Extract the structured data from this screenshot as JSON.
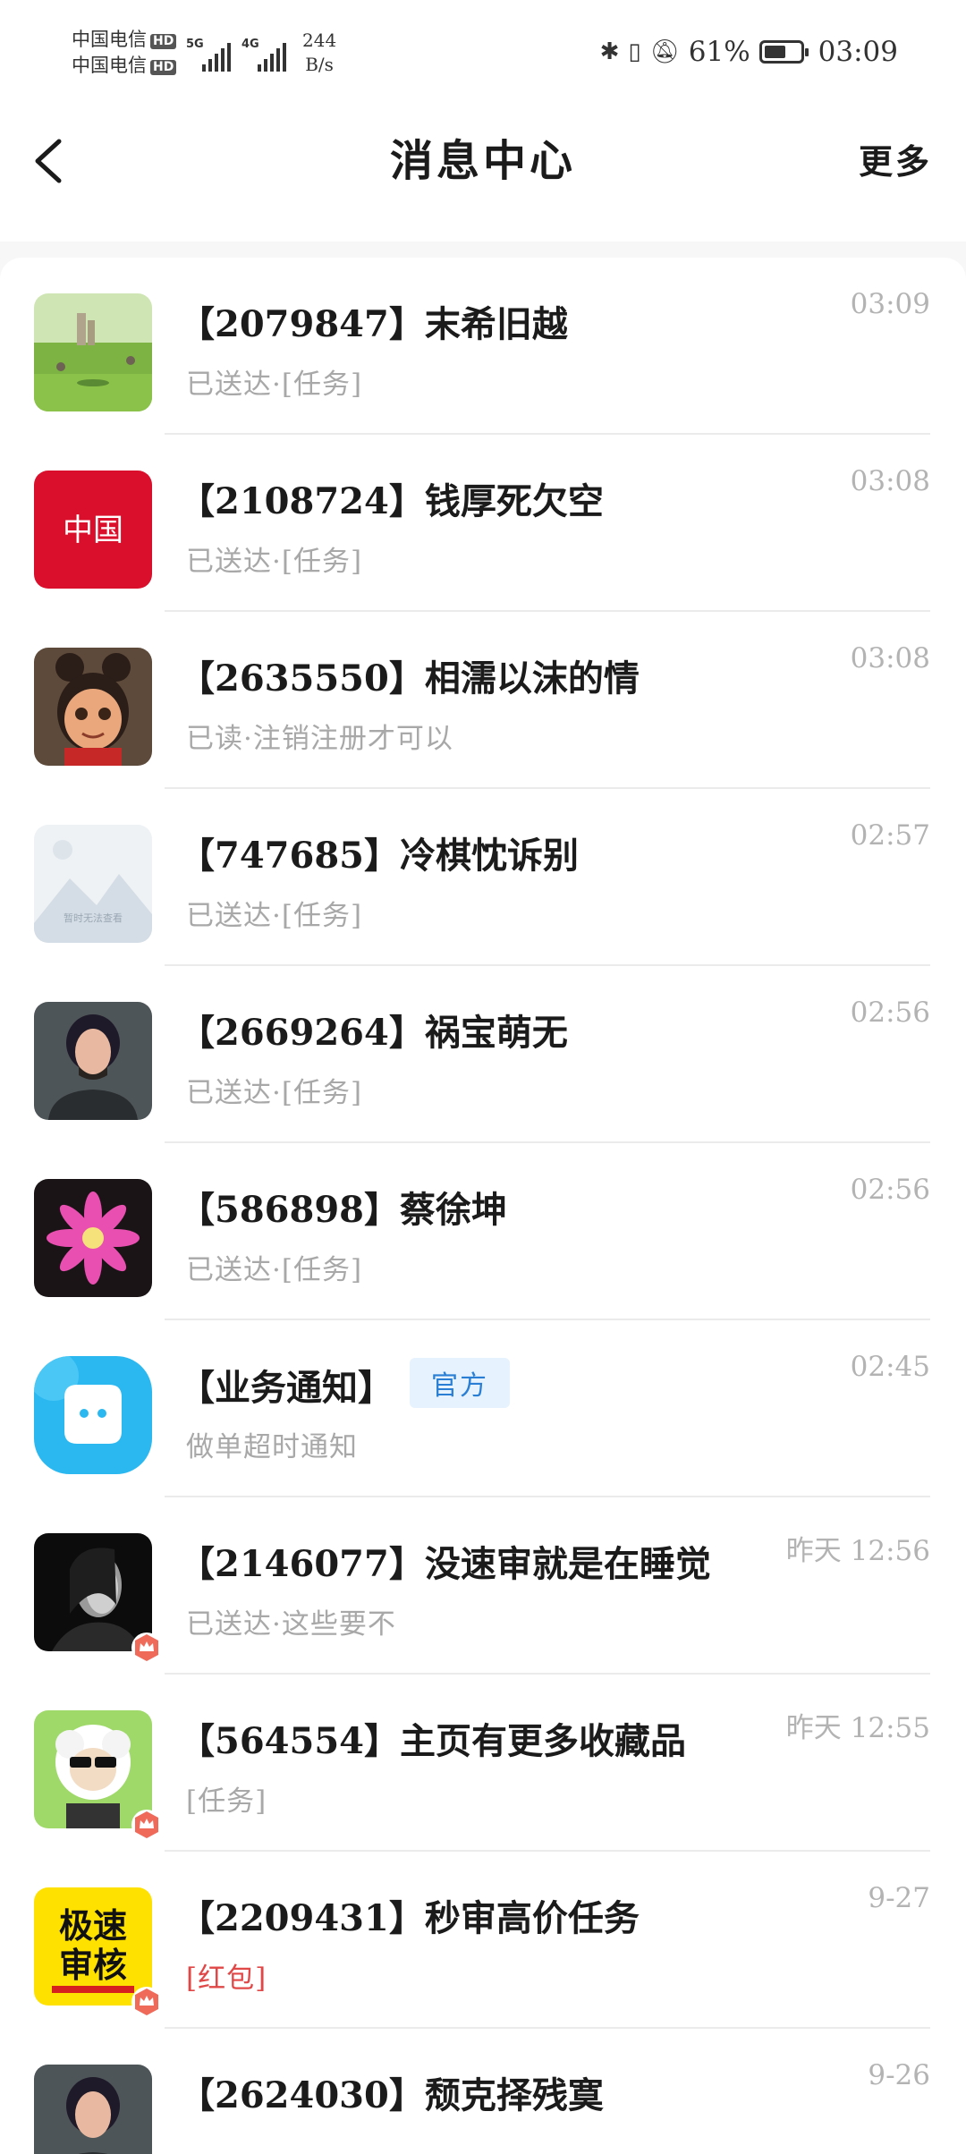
{
  "status_bar": {
    "carrier_1": "中国电信",
    "carrier_2": "中国电信",
    "hd": "HD",
    "net_1": "5G",
    "net_2": "4G",
    "speed_value": "244",
    "speed_unit": "B/s",
    "battery": "61%",
    "battery_level": 0.61,
    "time": "03:09",
    "icons": [
      "bluetooth-icon",
      "vibrate-icon",
      "mute-bell-icon",
      "battery-icon"
    ]
  },
  "header": {
    "title": "消息中心",
    "more_label": "更多",
    "back_icon": "chevron-left-icon"
  },
  "messages": [
    {
      "name": "【2079847】末希旧越",
      "sub": "已送达·[任务]",
      "time": "03:09",
      "avatar": "landscape-photo"
    },
    {
      "name": "【2108724】钱厚死欠空",
      "sub": "已送达·[任务]",
      "time": "03:08",
      "avatar": "red-logo",
      "avatar_text": "中国"
    },
    {
      "name": "【2635550】相濡以沫的情",
      "sub": "已读·注销注册才可以",
      "time": "03:08",
      "avatar": "cartoon-girl"
    },
    {
      "name": "【747685】冷棋忱诉别",
      "sub": "已送达·[任务]",
      "time": "02:57",
      "avatar": "placeholder-image",
      "avatar_text": "暂时无法查看"
    },
    {
      "name": "【2669264】祸宝萌无",
      "sub": "已送达·[任务]",
      "time": "02:56",
      "avatar": "person-silhouette"
    },
    {
      "name": "【586898】蔡徐坤",
      "sub": "已送达·[任务]",
      "time": "02:56",
      "avatar": "pink-flower"
    },
    {
      "name": "【业务通知】",
      "badge": "官方",
      "sub": "做单超时通知",
      "time": "02:45",
      "avatar": "chat-bubble"
    },
    {
      "name": "【2146077】没速审就是在睡觉",
      "sub": "已送达·这些要不",
      "time": "昨天 12:56",
      "avatar": "dark-portrait",
      "crown": true
    },
    {
      "name": "【564554】主页有更多收藏品",
      "sub": "[任务]",
      "time": "昨天 12:55",
      "avatar": "cartoon-sheep",
      "crown": true
    },
    {
      "name": "【2209431】秒审高价任务",
      "sub": "[红包]",
      "sub_color": "#e04848",
      "time": "9-27",
      "avatar": "yellow-badge",
      "avatar_text_1": "极速",
      "avatar_text_2": "审核",
      "crown": true
    },
    {
      "name": "【2624030】颓克择残寞",
      "sub": "",
      "time": "9-26",
      "avatar": "person-silhouette"
    }
  ]
}
